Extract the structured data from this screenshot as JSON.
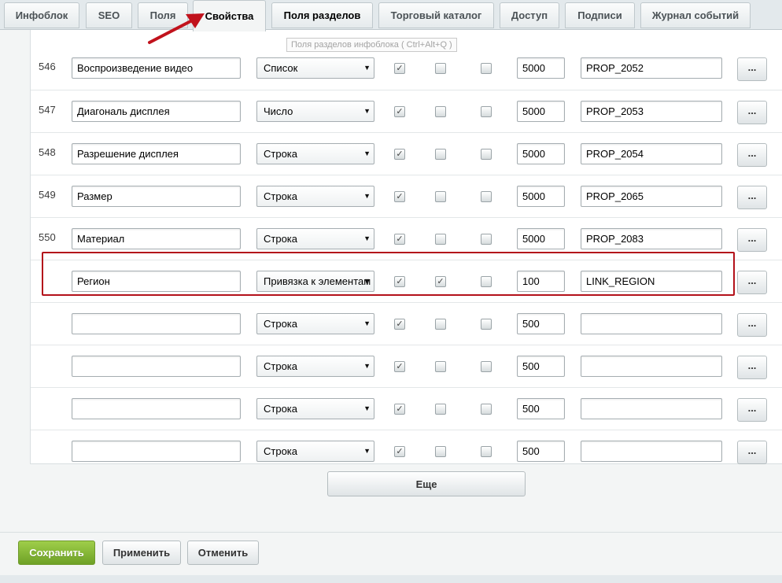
{
  "tabs": [
    {
      "label": "Инфоблок"
    },
    {
      "label": "SEO"
    },
    {
      "label": "Поля"
    },
    {
      "label": "Свойства"
    },
    {
      "label": "Поля разделов"
    },
    {
      "label": "Торговый каталог"
    },
    {
      "label": "Доступ"
    },
    {
      "label": "Подписи"
    },
    {
      "label": "Журнал событий"
    }
  ],
  "tooltip": "Поля разделов инфоблока ( Ctrl+Alt+Q )",
  "check_mark": "✓",
  "caret": "▼",
  "properties": [
    {
      "id": "546",
      "name": "Воспроизведение видео",
      "type": "Список",
      "c1": true,
      "c2": false,
      "c3": false,
      "sort": "5000",
      "code": "PROP_2052",
      "dots": "..."
    },
    {
      "id": "547",
      "name": "Диагональ дисплея",
      "type": "Число",
      "c1": true,
      "c2": false,
      "c3": false,
      "sort": "5000",
      "code": "PROP_2053",
      "dots": "..."
    },
    {
      "id": "548",
      "name": "Разрешение дисплея",
      "type": "Строка",
      "c1": true,
      "c2": false,
      "c3": false,
      "sort": "5000",
      "code": "PROP_2054",
      "dots": "..."
    },
    {
      "id": "549",
      "name": "Размер",
      "type": "Строка",
      "c1": true,
      "c2": false,
      "c3": false,
      "sort": "5000",
      "code": "PROP_2065",
      "dots": "..."
    },
    {
      "id": "550",
      "name": "Материал",
      "type": "Строка",
      "c1": true,
      "c2": false,
      "c3": false,
      "sort": "5000",
      "code": "PROP_2083",
      "dots": "..."
    },
    {
      "id": "",
      "name": "Регион",
      "type": "Привязка к элементам",
      "c1": true,
      "c2": true,
      "c3": false,
      "sort": "100",
      "code": "LINK_REGION",
      "dots": "..."
    },
    {
      "id": "",
      "name": "",
      "type": "Строка",
      "c1": true,
      "c2": false,
      "c3": false,
      "sort": "500",
      "code": "",
      "dots": "..."
    },
    {
      "id": "",
      "name": "",
      "type": "Строка",
      "c1": true,
      "c2": false,
      "c3": false,
      "sort": "500",
      "code": "",
      "dots": "..."
    },
    {
      "id": "",
      "name": "",
      "type": "Строка",
      "c1": true,
      "c2": false,
      "c3": false,
      "sort": "500",
      "code": "",
      "dots": "..."
    },
    {
      "id": "",
      "name": "",
      "type": "Строка",
      "c1": true,
      "c2": false,
      "c3": false,
      "sort": "500",
      "code": "",
      "dots": "..."
    }
  ],
  "more_label": "Еще",
  "footer": {
    "save": "Сохранить",
    "apply": "Применить",
    "cancel": "Отменить"
  },
  "colors": {
    "highlight_border": "#b3111a",
    "arrow": "#c1121c",
    "save_button": "#7db132"
  }
}
